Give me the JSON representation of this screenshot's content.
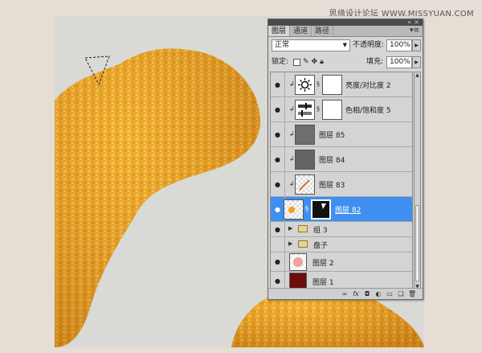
{
  "watermark": "思缘设计论坛 WWW.MISSYUAN.COM",
  "panel": {
    "tabs": [
      "图层",
      "通道",
      "路径"
    ],
    "active_tab": 0,
    "blend_mode": "正常",
    "opacity_label": "不透明度:",
    "opacity_value": "100%",
    "lock_label": "锁定:",
    "fill_label": "填充:",
    "fill_value": "100%",
    "layers": [
      {
        "name": "亮度/对比度 2",
        "kind": "adjustment",
        "clipped": true,
        "selected": false
      },
      {
        "name": "色相/饱和度 5",
        "kind": "adjustment",
        "clipped": true,
        "selected": false
      },
      {
        "name": "图层 85",
        "kind": "pixel",
        "clipped": true,
        "selected": false
      },
      {
        "name": "图层 84",
        "kind": "pixel",
        "clipped": true,
        "selected": false
      },
      {
        "name": "图层 83",
        "kind": "pixel",
        "clipped": true,
        "selected": false
      },
      {
        "name": "图层 82",
        "kind": "masked",
        "clipped": false,
        "selected": true
      },
      {
        "name": "组 3",
        "kind": "group",
        "selected": false
      },
      {
        "name": "盘子",
        "kind": "group",
        "selected": false,
        "hidden": true
      },
      {
        "name": "图层 2",
        "kind": "pixel",
        "selected": false
      },
      {
        "name": "图层 1",
        "kind": "pixel",
        "selected": false
      }
    ],
    "bottom_icons": [
      "link-icon",
      "fx-icon",
      "mask-icon",
      "adjustment-icon",
      "folder-icon",
      "new-layer-icon",
      "trash-icon"
    ]
  },
  "colors": {
    "selection": "#3e8ff0",
    "layer1_fill": "#6b0d0d",
    "food_orange": "#f0a020"
  }
}
